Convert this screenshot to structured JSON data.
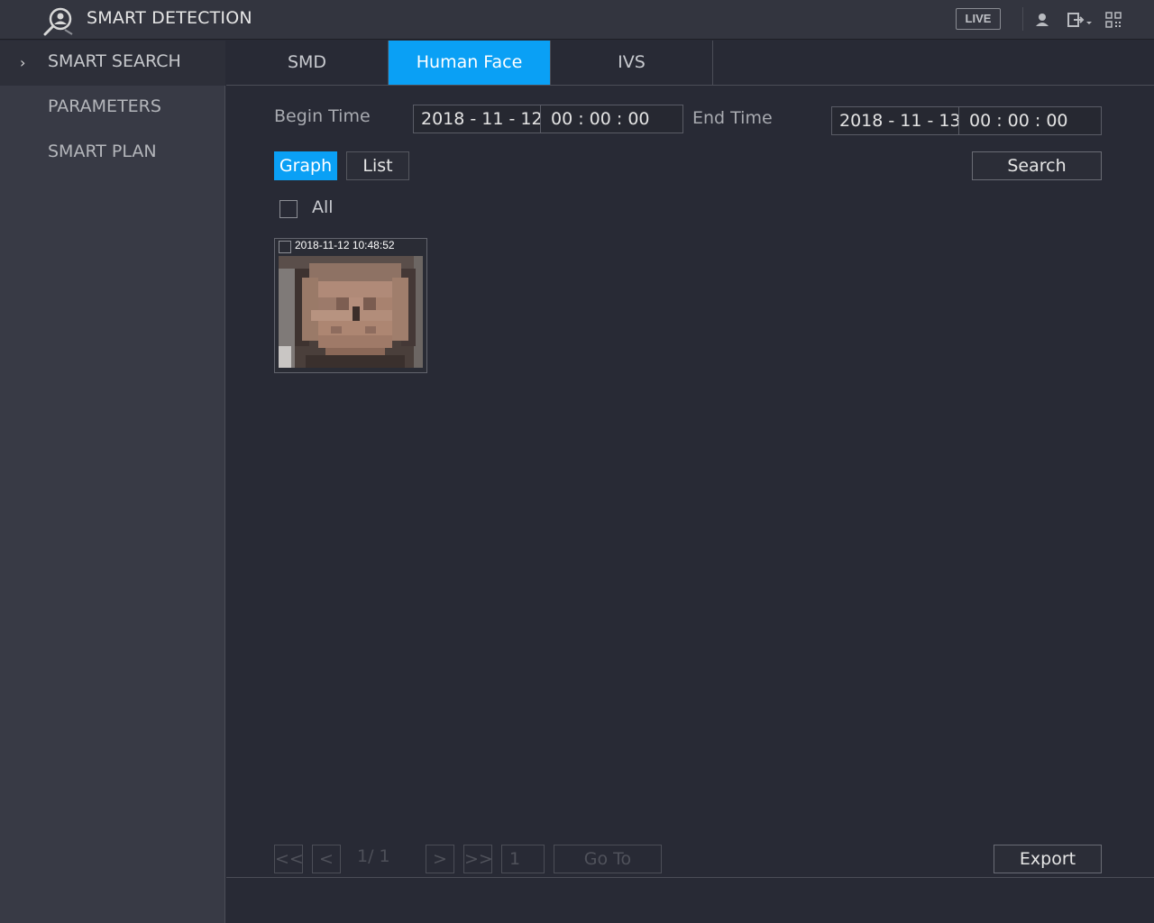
{
  "header": {
    "title": "SMART DETECTION",
    "live_label": "LIVE",
    "icons": [
      "user-icon",
      "logout-icon",
      "qr-code-icon"
    ]
  },
  "sidebar": {
    "items": [
      {
        "label": "SMART SEARCH",
        "active": true
      },
      {
        "label": "PARAMETERS",
        "active": false
      },
      {
        "label": "SMART PLAN",
        "active": false
      }
    ]
  },
  "tabs": [
    {
      "label": "SMD",
      "active": false
    },
    {
      "label": "Human Face",
      "active": true
    },
    {
      "label": "IVS",
      "active": false
    }
  ],
  "search": {
    "begin_label": "Begin Time",
    "begin_date": "2018 - 11 - 12",
    "begin_time": "00 : 00 : 00",
    "end_label": "End Time",
    "end_date": "2018 - 11 - 13",
    "end_time": "00 : 00 : 00",
    "search_label": "Search"
  },
  "view": {
    "graph_label": "Graph",
    "list_label": "List",
    "selected": "Graph"
  },
  "select_all_label": "All",
  "results": [
    {
      "timestamp": "2018-11-12 10:48:52",
      "checked": false
    }
  ],
  "pagination": {
    "first_label": "<<",
    "prev_label": "<",
    "page_info": "1/ 1",
    "next_label": ">",
    "last_label": ">>",
    "page_input": "1",
    "goto_label": "Go To"
  },
  "export_label": "Export",
  "colors": {
    "accent": "#0aa0f5",
    "background": "#282a35",
    "sidebar": "#383a45"
  }
}
